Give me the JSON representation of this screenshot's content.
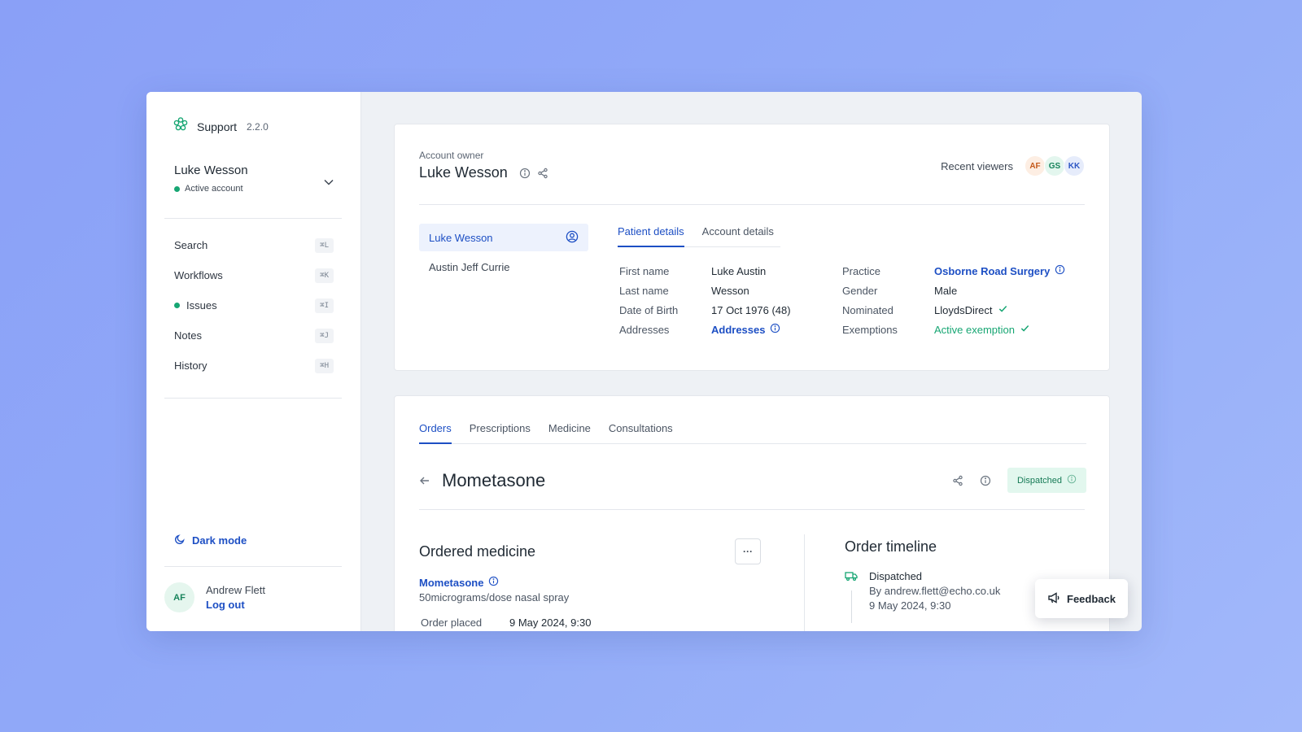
{
  "app": {
    "name": "Support",
    "version": "2.2.0"
  },
  "account": {
    "name": "Luke Wesson",
    "status": "Active account"
  },
  "nav": [
    {
      "label": "Search",
      "shortcut": "⌘L"
    },
    {
      "label": "Workflows",
      "shortcut": "⌘K"
    },
    {
      "label": "Issues",
      "shortcut": "⌘I"
    },
    {
      "label": "Notes",
      "shortcut": "⌘J"
    },
    {
      "label": "History",
      "shortcut": "⌘H"
    }
  ],
  "sidebar": {
    "dark_mode": "Dark mode"
  },
  "user": {
    "initials": "AF",
    "name": "Andrew Flett",
    "logout": "Log out"
  },
  "owner": {
    "label": "Account owner",
    "name": "Luke Wesson"
  },
  "viewers": {
    "label": "Recent viewers",
    "list": [
      "AF",
      "GS",
      "KK"
    ]
  },
  "people": [
    "Luke Wesson",
    "Austin Jeff Currie"
  ],
  "detail_tabs": [
    "Patient details",
    "Account details"
  ],
  "patient": {
    "first_name_label": "First name",
    "first_name": "Luke Austin",
    "last_name_label": "Last name",
    "last_name": "Wesson",
    "dob_label": "Date of Birth",
    "dob": "17 Oct 1976 (48)",
    "addresses_label": "Addresses",
    "addresses": "Addresses",
    "practice_label": "Practice",
    "practice": "Osborne Road Surgery",
    "gender_label": "Gender",
    "gender": "Male",
    "nominated_label": "Nominated",
    "nominated": "LloydsDirect",
    "exemptions_label": "Exemptions",
    "exemptions": "Active exemption"
  },
  "order_tabs": [
    "Orders",
    "Prescriptions",
    "Medicine",
    "Consultations"
  ],
  "order": {
    "title": "Mometasone",
    "status": "Dispatched",
    "ordered_title": "Ordered medicine",
    "more": "···",
    "medicine_name": "Mometasone",
    "medicine_desc": "50micrograms/dose nasal spray",
    "placed_label": "Order placed",
    "placed_value": "9 May 2024, 9:30"
  },
  "timeline": {
    "title": "Order timeline",
    "event": "Dispatched",
    "by": "By andrew.flett@echo.co.uk",
    "time": "9 May 2024, 9:30"
  },
  "feedback": "Feedback"
}
